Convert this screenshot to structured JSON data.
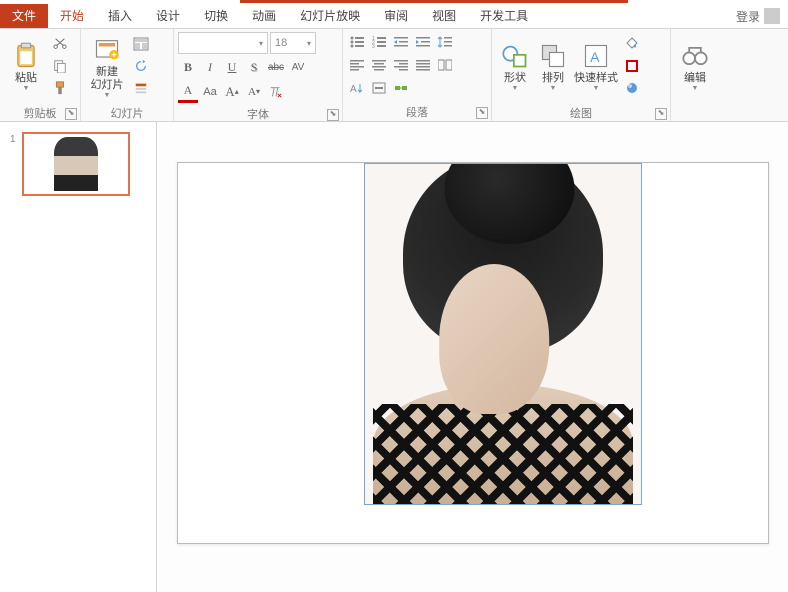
{
  "tabs": {
    "file": "文件",
    "home": "开始",
    "insert": "插入",
    "design": "设计",
    "transition": "切换",
    "animation": "动画",
    "slideshow": "幻灯片放映",
    "review": "审阅",
    "view": "视图",
    "developer": "开发工具"
  },
  "login": "登录",
  "groups": {
    "clipboard": "剪贴板",
    "slides": "幻灯片",
    "font": "字体",
    "paragraph": "段落",
    "drawing": "绘图",
    "editing": "编辑"
  },
  "clipboard": {
    "paste": "粘贴"
  },
  "slides": {
    "new": "新建\n幻灯片"
  },
  "font": {
    "name": "",
    "size": "18",
    "bold": "B",
    "italic": "I",
    "underline": "U",
    "shadow": "S",
    "strike": "abc",
    "spacing": "AV",
    "color": "A",
    "clear": "Aa",
    "grow": "A",
    "shrink": "A"
  },
  "drawing": {
    "shape": "形状",
    "arrange": "排列",
    "quickstyle": "快速样式"
  },
  "thumb": {
    "num": "1"
  }
}
